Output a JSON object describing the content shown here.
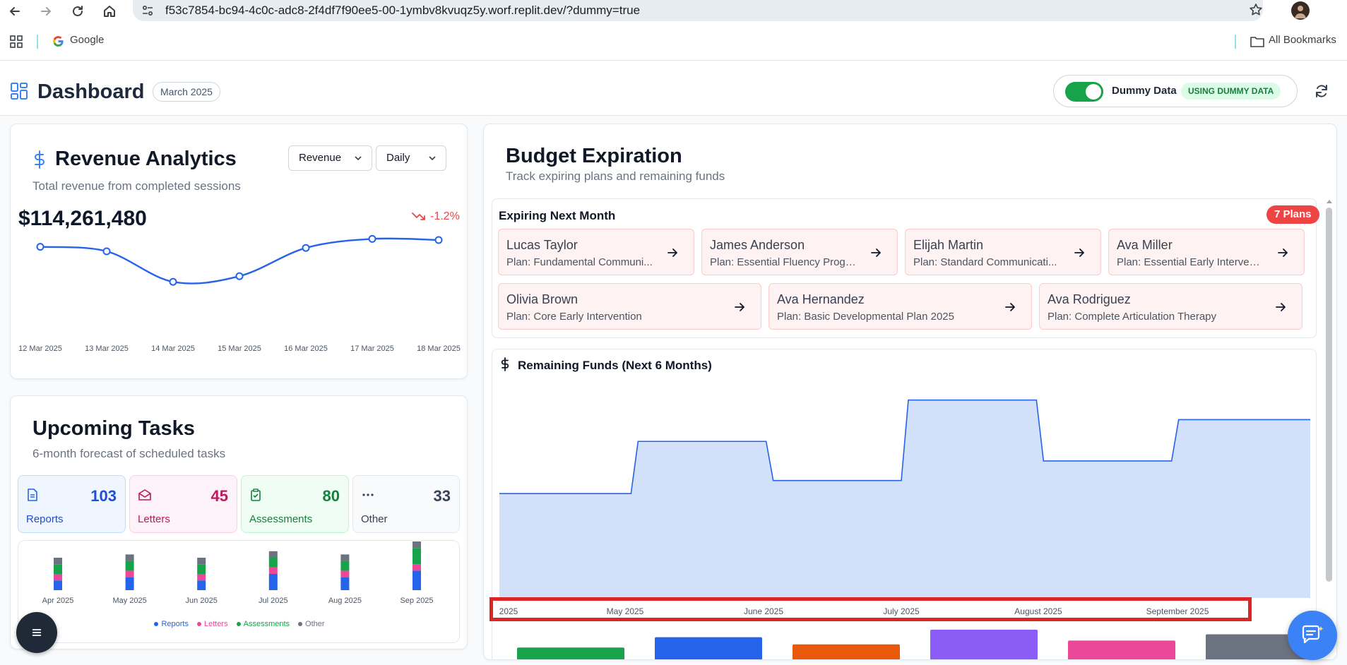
{
  "browser": {
    "url": "f53c7854-bc94-4c0c-adc8-2f4df7f90ee5-00-1ymbv8kvuqz5y.worf.replit.dev/?dummy=true",
    "bookmarks": {
      "google": "Google",
      "all": "All Bookmarks"
    }
  },
  "header": {
    "title": "Dashboard",
    "month": "March 2025",
    "dummy_label": "Dummy Data",
    "dummy_badge": "USING DUMMY DATA",
    "dummy_enabled": true
  },
  "revenue": {
    "title": "Revenue Analytics",
    "subtitle": "Total revenue from completed sessions",
    "metric_select": "Revenue",
    "period_select": "Daily",
    "total": "$114,261,480",
    "change": "-1.2%",
    "chart_data": {
      "type": "line",
      "x": [
        "12 Mar 2025",
        "13 Mar 2025",
        "14 Mar 2025",
        "15 Mar 2025",
        "16 Mar 2025",
        "17 Mar 2025",
        "18 Mar 2025"
      ],
      "values": [
        0.79,
        0.75,
        0.48,
        0.53,
        0.78,
        0.86,
        0.85
      ],
      "color": "#2563eb"
    }
  },
  "tasks": {
    "title": "Upcoming Tasks",
    "subtitle": "6-month forecast of scheduled tasks",
    "stats": [
      {
        "label": "Reports",
        "count": "103",
        "icon": "file-text-icon"
      },
      {
        "label": "Letters",
        "count": "45",
        "icon": "mail-open-icon"
      },
      {
        "label": "Assessments",
        "count": "80",
        "icon": "clipboard-check-icon"
      },
      {
        "label": "Other",
        "count": "33",
        "icon": "more-horizontal-icon"
      }
    ],
    "chart_data": {
      "type": "bar",
      "stacked": true,
      "categories": [
        "Apr 2025",
        "May 2025",
        "Jun 2025",
        "Jul 2025",
        "Aug 2025",
        "Sep 2025"
      ],
      "series": [
        {
          "name": "Reports",
          "color": "#2563eb",
          "values": [
            3,
            4,
            3,
            5,
            4,
            6
          ]
        },
        {
          "name": "Letters",
          "color": "#ec4899",
          "values": [
            2,
            2,
            2,
            2,
            2,
            2
          ]
        },
        {
          "name": "Assessments",
          "color": "#16a34a",
          "values": [
            3,
            3,
            3,
            3,
            3,
            5
          ]
        },
        {
          "name": "Other",
          "color": "#6b7280",
          "values": [
            2,
            2,
            2,
            2,
            2,
            2
          ]
        }
      ]
    }
  },
  "budget": {
    "title": "Budget Expiration",
    "subtitle": "Track expiring plans and remaining funds",
    "expiring_title": "Expiring Next Month",
    "plans_badge": "7 Plans",
    "plans": [
      {
        "name": "Lucas Taylor",
        "plan": "Plan: Fundamental Communi..."
      },
      {
        "name": "James Anderson",
        "plan": "Plan: Essential Fluency Progr..."
      },
      {
        "name": "Elijah Martin",
        "plan": "Plan: Standard Communicati..."
      },
      {
        "name": "Ava Miller",
        "plan": "Plan: Essential Early Intervent..."
      },
      {
        "name": "Olivia Brown",
        "plan": "Plan: Core Early Intervention"
      },
      {
        "name": "Ava Hernandez",
        "plan": "Plan: Basic Developmental Plan 2025"
      },
      {
        "name": "Ava Rodriguez",
        "plan": "Plan: Complete Articulation Therapy"
      }
    ],
    "funds_title": "Remaining Funds (Next 6 Months)",
    "chart_data": {
      "type": "area",
      "step": true,
      "categories": [
        "2025",
        "May 2025",
        "June 2025",
        "July 2025",
        "August 2025",
        "September 2025"
      ],
      "values": [
        0.48,
        0.72,
        0.54,
        0.91,
        0.63,
        0.82
      ],
      "color": "#2563eb",
      "fill": "#d3e0fa"
    },
    "legend_bars": [
      {
        "color": "#16a34a",
        "value": 0.1
      },
      {
        "color": "#2563eb",
        "value": 0.62
      },
      {
        "color": "#ea580c",
        "value": 0.26
      },
      {
        "color": "#8b5cf6",
        "value": 1.0
      },
      {
        "color": "#ec4899",
        "value": 0.45
      },
      {
        "color": "#6b7280",
        "value": 0.77
      }
    ]
  }
}
